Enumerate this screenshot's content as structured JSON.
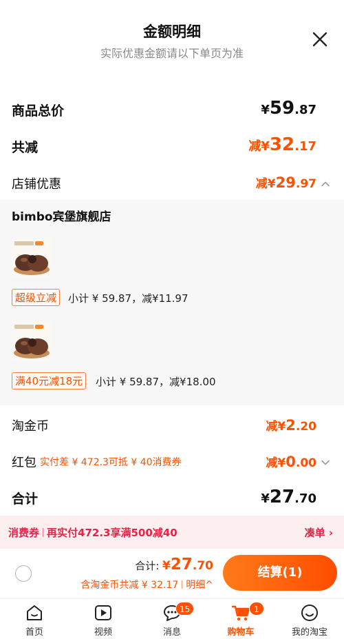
{
  "header": {
    "title": "金额明细",
    "subtitle": "实际优惠金额请以下单页为准"
  },
  "summary": {
    "goods_total_label": "商品总价",
    "goods_total": {
      "yen": "¥",
      "int": "59",
      "dec": ".87"
    },
    "reduced_label": "共减",
    "reduced": {
      "prefix": "减¥",
      "int": "32",
      "dec": ".17"
    },
    "store_discount_label": "店铺优惠",
    "store_discount": {
      "prefix": "减¥",
      "int": "29",
      "dec": ".97"
    }
  },
  "store": {
    "name": "bimbo宾堡旗舰店",
    "items": [
      {
        "tag": "超级立减",
        "subtotal": "小计 ¥ 59.87，减¥11.97"
      },
      {
        "tag": "满40元减18元",
        "subtotal": "小计 ¥ 59.87，减¥18.00"
      }
    ]
  },
  "coins": {
    "label": "淘金币",
    "amount": {
      "prefix": "减¥",
      "int": "2",
      "dec": ".20"
    }
  },
  "redpacket": {
    "label": "红包",
    "note": "实付差 ¥ 472.3可抵 ¥ 40消费券",
    "amount": {
      "prefix": "减¥",
      "int": "0",
      "dec": ".00"
    }
  },
  "total": {
    "label": "合计",
    "amount": {
      "yen": "¥",
      "int": "27",
      "dec": ".70"
    }
  },
  "promo": {
    "tag": "消费券",
    "text": "再实付472.3享满500减40",
    "action": "凑单 ›"
  },
  "checkout": {
    "total_label": "合计: ",
    "total": {
      "yen": "¥",
      "int": "27",
      "dec": ".70"
    },
    "savings": "含淘金币共减 ¥ 32.17",
    "detail": "明细^",
    "button": "结算(1)"
  },
  "tabbar": [
    {
      "label": "首页",
      "icon": "home-icon"
    },
    {
      "label": "视频",
      "icon": "video-icon"
    },
    {
      "label": "消息",
      "icon": "message-icon",
      "badge": "15"
    },
    {
      "label": "购物车",
      "icon": "cart-icon",
      "badge": "1",
      "active": true
    },
    {
      "label": "我的淘宝",
      "icon": "profile-icon"
    }
  ],
  "colors": {
    "accent": "#ff5000",
    "promo": "#e8234a"
  }
}
